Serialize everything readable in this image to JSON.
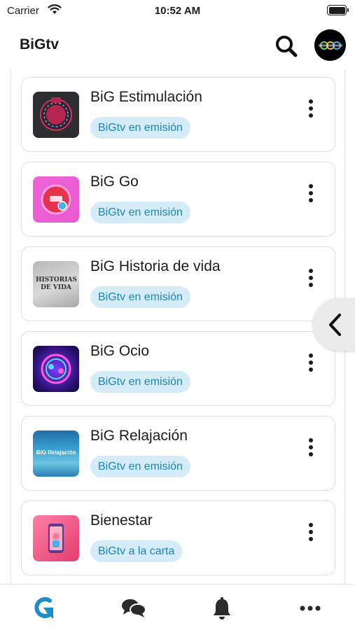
{
  "status_bar": {
    "carrier": "Carrier",
    "time": "10:52 AM"
  },
  "header": {
    "title": "BiGtv",
    "search_icon": "search-icon",
    "avatar_icon": "profile-avatar"
  },
  "channels": [
    {
      "title": "BiG Estimulación",
      "badge": "BiGtv en emisión",
      "thumb": "big-estimulacion-logo"
    },
    {
      "title": "BiG Go",
      "badge": "BiGtv en emisión",
      "thumb": "big-go-logo"
    },
    {
      "title": "BiG Historia de vida",
      "badge": "BiGtv en emisión",
      "thumb": "historias-de-vida-logo",
      "thumb_text": "HISTORIAS DE VIDA"
    },
    {
      "title": "BiG Ocio",
      "badge": "BiGtv en emisión",
      "thumb": "big-ocio-logo"
    },
    {
      "title": "BiG Relajación",
      "badge": "BiGtv en emisión",
      "thumb": "big-relajacion-logo",
      "thumb_text": "BiG Relajación"
    },
    {
      "title": "Bienestar",
      "badge": "BiGtv a la carta",
      "thumb": "bienestar-logo"
    }
  ],
  "tab_bar": {
    "items": [
      "home-logo-icon",
      "chat-icon",
      "bell-icon",
      "more-horizontal-icon"
    ],
    "active_color": "#1e8ec8"
  },
  "colors": {
    "badge_bg": "#d3ecf8",
    "badge_text": "#1e84b4"
  }
}
